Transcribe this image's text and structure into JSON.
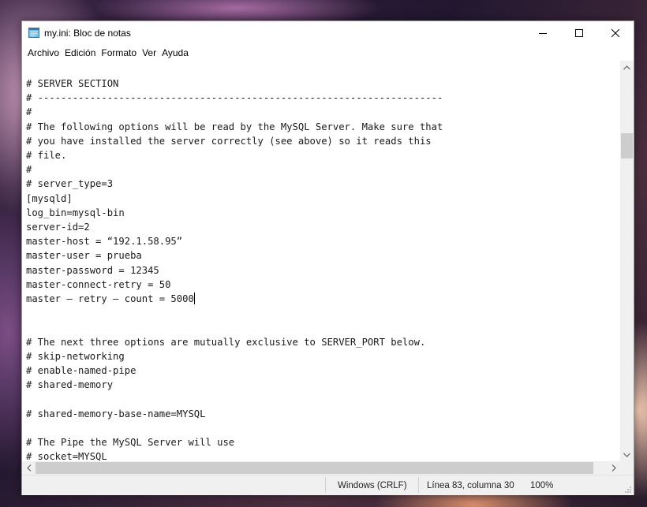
{
  "window": {
    "title": "my.ini: Bloc de notas",
    "controls": {
      "minimize": "minimize-icon",
      "maximize": "maximize-icon",
      "close": "close-icon"
    }
  },
  "menu": {
    "items": [
      "Archivo",
      "Edición",
      "Formato",
      "Ver",
      "Ayuda"
    ]
  },
  "editor": {
    "lines": [
      "# SERVER SECTION",
      "# ----------------------------------------------------------------------",
      "#",
      "# The following options will be read by the MySQL Server. Make sure that",
      "# you have installed the server correctly (see above) so it reads this",
      "# file.",
      "#",
      "# server_type=3",
      "[mysqld]",
      "log_bin=mysql-bin",
      "server-id=2",
      "master-host = “192.1.58.95”",
      "master-user = prueba",
      "master-password = 12345",
      "master-connect-retry = 50",
      "master – retry – count = 5000",
      "",
      "",
      "# The next three options are mutually exclusive to SERVER_PORT below.",
      "# skip-networking",
      "# enable-named-pipe",
      "# shared-memory",
      "",
      "# shared-memory-base-name=MYSQL",
      "",
      "# The Pipe the MySQL Server will use",
      "# socket=MYSQL"
    ],
    "caret_line": 15
  },
  "statusbar": {
    "line_ending": "Windows (CRLF)",
    "position": "Línea 83, columna 30",
    "zoom": "100%"
  },
  "colors": {
    "window_bg": "#ffffff",
    "chrome_bg": "#f0f0f0",
    "scroll_thumb": "#cdcdcd",
    "text": "#1a1a1a"
  }
}
